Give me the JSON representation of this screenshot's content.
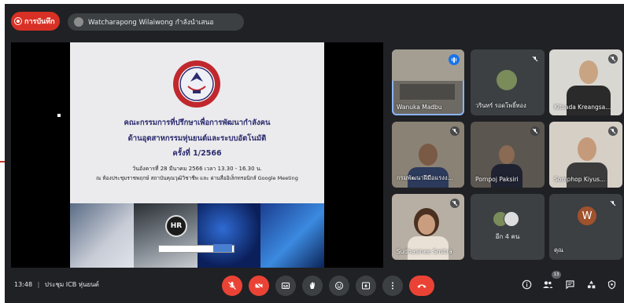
{
  "recording": {
    "label": "การบันทึก"
  },
  "presenter": {
    "text": "Watcharapong Wilaiwong กำลังนำเสนอ"
  },
  "slide": {
    "line1": "คณะกรรมการที่ปรึกษาเพื่อการพัฒนากำลังคน",
    "line2": "ด้านอุตสาหกรรมหุ่นยนต์และระบบอัตโนมัติ",
    "line3": "ครั้งที่ 1/2566",
    "date_line": "วันอังคารที่ 28 มีนาคม 2566 เวลา 13.30 - 16.30 น.",
    "place_line": "ณ ห้องประชุมราชพฤกษ์ สถาบันคุณวุฒิวิชาชีพ และ ผ่านสื่ออิเล็กทรอนิกส์ Google Meeting",
    "hr_badge": "HR"
  },
  "participants": [
    {
      "name": "Wanuka Madbu"
    },
    {
      "name": "วรินทร์ รอดโพธิ์ทอง"
    },
    {
      "name": "Kitsada Kreangsa..."
    },
    {
      "name": "กรมพัฒนาฝีมือแรงง..."
    },
    {
      "name": "Pornpoj Paksiri"
    },
    {
      "name": "Somphop Kiyus..."
    },
    {
      "name": "Sudhasinee Smitra"
    },
    {
      "name": "อีก 4 คน"
    },
    {
      "name": "คุณ",
      "avatar_letter": "W"
    }
  ],
  "bottom_bar": {
    "time": "13:48",
    "separator": "|",
    "meeting_name": "ประชุม ICB หุ่นยนต์",
    "people_count": "13"
  },
  "colors": {
    "accent": "#8ab4f8",
    "danger": "#ea4335",
    "surface": "#3c4043",
    "background": "#202124"
  }
}
